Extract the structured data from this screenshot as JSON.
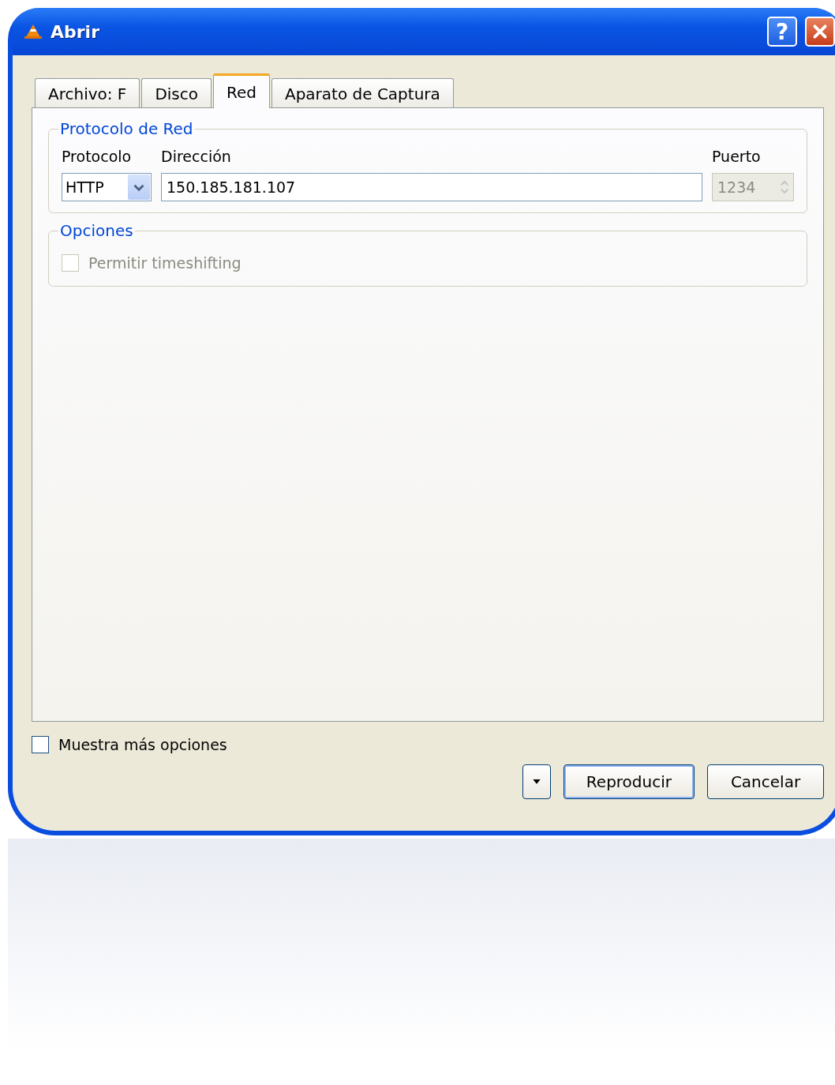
{
  "window": {
    "title": "Abrir",
    "help_button": "?"
  },
  "tabs": [
    {
      "label": "Archivo: F",
      "selected": false
    },
    {
      "label": "Disco",
      "selected": false
    },
    {
      "label": "Red",
      "selected": true
    },
    {
      "label": "Aparato de Captura",
      "selected": false
    }
  ],
  "network_group": {
    "title": "Protocolo de Red",
    "protocol_label": "Protocolo",
    "protocol_value": "HTTP",
    "address_label": "Dirección",
    "address_value": "150.185.181.107",
    "port_label": "Puerto",
    "port_value": "1234",
    "port_disabled": true
  },
  "options_group": {
    "title": "Opciones",
    "checkbox": {
      "label": "Permitir timeshifting",
      "checked": false,
      "disabled": true
    }
  },
  "more_options": {
    "label": "Muestra más opciones",
    "checked": false
  },
  "buttons": [
    {
      "kind": "dropdown"
    },
    {
      "kind": "default",
      "label": "Reproducir"
    },
    {
      "kind": "normal",
      "label": "Cancelar"
    }
  ]
}
